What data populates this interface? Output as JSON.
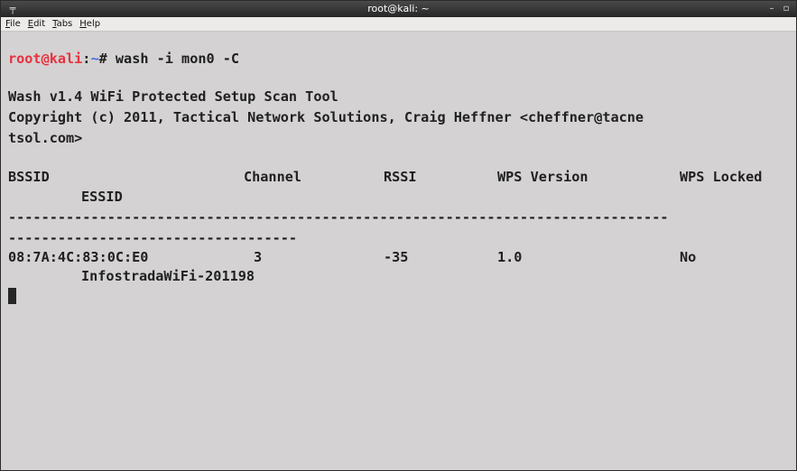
{
  "window": {
    "title": "root@kali: ~",
    "app_icon": "terminal-icon",
    "minimize_icon": "minimize-icon",
    "maximize_icon": "maximize-icon"
  },
  "menubar": {
    "items": [
      {
        "mnemonic": "F",
        "rest": "ile"
      },
      {
        "mnemonic": "E",
        "rest": "dit"
      },
      {
        "mnemonic": "T",
        "rest": "abs"
      },
      {
        "mnemonic": "H",
        "rest": "elp"
      }
    ]
  },
  "terminal": {
    "prompt": {
      "user": "root@kali",
      "sep": ":",
      "path": "~",
      "hash": "# ",
      "command": "wash -i mon0 -C"
    },
    "banner1": "Wash v1.4 WiFi Protected Setup Scan Tool",
    "banner2a": "Copyright (c) 2011, Tactical Network Solutions, Craig Heffner <cheffner@tacne",
    "banner2b": "tsol.com>",
    "header": {
      "bssid": "BSSID",
      "channel": "Channel",
      "rssi": "RSSI",
      "wps_version": "WPS Version",
      "wps_locked": "WPS Locked",
      "essid": "ESSID"
    },
    "separator1": "--------------------------------------------------------------------------------",
    "separator2": "-----------------------------------",
    "rows": [
      {
        "bssid": "08:7A:4C:83:0C:E0",
        "channel": "3",
        "rssi": "-35",
        "wps_version": "1.0",
        "wps_locked": "No",
        "essid": "InfostradaWiFi-201198"
      }
    ]
  }
}
